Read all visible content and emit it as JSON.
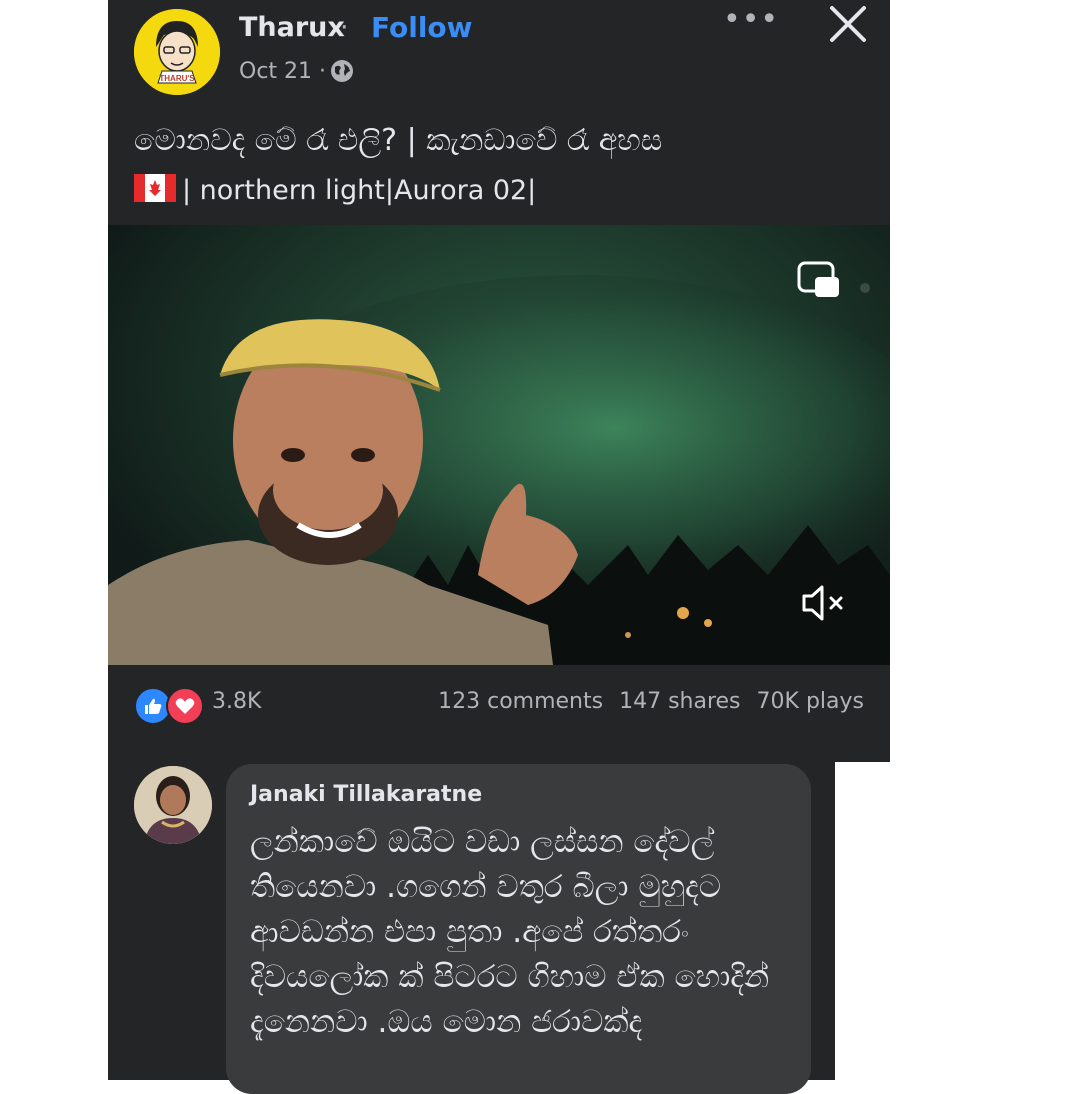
{
  "post": {
    "author": "Tharux",
    "separator": "·",
    "follow_label": "Follow",
    "date": "Oct 21 ·",
    "caption_line1": "මොනවද මේ රෑ එලි?  | කැනඩාවේ රෑ අහස",
    "caption_line2": "| northern light|Aurora 02|",
    "avatar_text": "THARU'S"
  },
  "stats": {
    "reactions": "3.8K",
    "comments": "123 comments",
    "shares": "147 shares",
    "plays": "70K plays"
  },
  "comment": {
    "author": "Janaki Tillakaratne",
    "text": "ලන්කාවේ ඔයිට වඩා ලස්සන දේවල් තියෙනවා .ගගෙන් වතුර බීලා මුහුදට ආවඩන්න එපා පුතා .අපේ රත්තරං දිවයලෝක ක් පිටරට ගිහාම ඒක හොදින් දැනෙනවා .ඔය මොන ජරාවක්ද"
  },
  "colors": {
    "background": "#242526",
    "follow": "#3a8df5",
    "like": "#2d88ff",
    "love": "#f33e58",
    "bubble": "#3a3b3c"
  },
  "icons": [
    "globe-icon",
    "more-options-icon",
    "close-icon",
    "picture-in-picture-icon",
    "mute-icon",
    "like-reaction-icon",
    "love-reaction-icon",
    "canada-flag-icon"
  ]
}
